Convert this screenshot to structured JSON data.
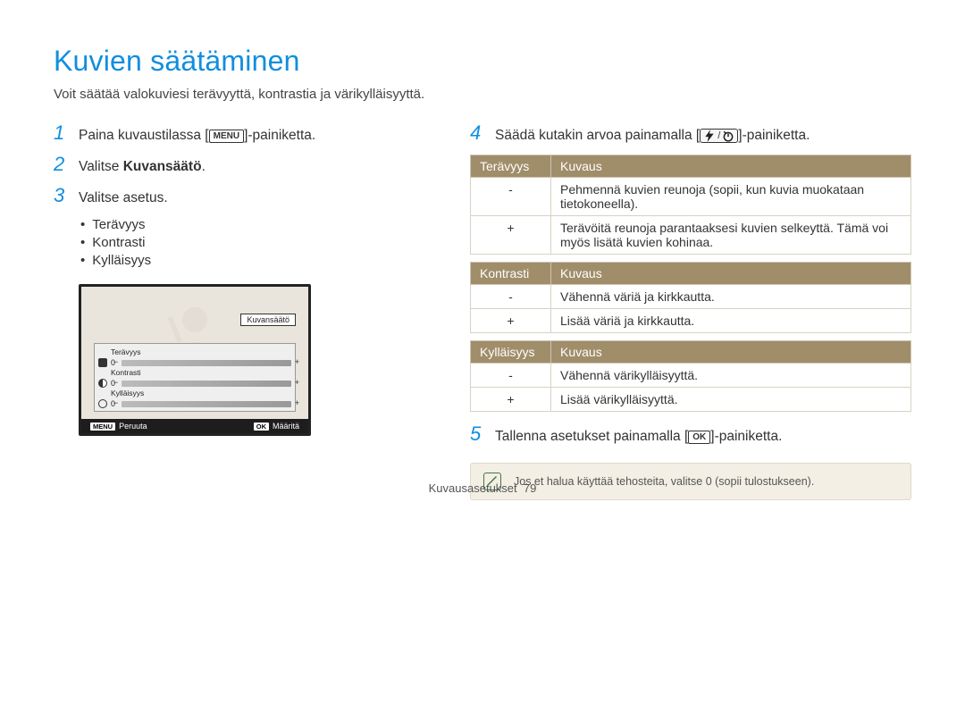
{
  "title": "Kuvien säätäminen",
  "subtitle": "Voit säätää valokuviesi terävyyttä, kontrastia ja värikylläisyyttä.",
  "steps": {
    "s1": {
      "num": "1",
      "pre": "Paina kuvaustilassa [",
      "icon": "MENU",
      "post": "]-painiketta."
    },
    "s2": {
      "num": "2",
      "pre": "Valitse ",
      "bold": "Kuvansäätö",
      "post": "."
    },
    "s3": {
      "num": "3",
      "text": "Valitse asetus."
    },
    "s4": {
      "num": "4",
      "pre": "Säädä kutakin arvoa painamalla [",
      "iconA": "flash-icon",
      "slash": "/",
      "iconB": "timer-icon",
      "post": "]-painiketta."
    },
    "s5": {
      "num": "5",
      "pre": "Tallenna asetukset painamalla [",
      "icon": "OK",
      "post": "]-painiketta."
    }
  },
  "bullets": [
    "Terävyys",
    "Kontrasti",
    "Kylläisyys"
  ],
  "lcd": {
    "title": "Kuvansäätö",
    "rows": [
      {
        "label": "Terävyys",
        "icon": "sq"
      },
      {
        "label": "Kontrasti",
        "icon": "half"
      },
      {
        "label": "Kylläisyys",
        "icon": "circ"
      }
    ],
    "zero": "0",
    "cancel_tag": "MENU",
    "cancel_label": "Peruuta",
    "ok_tag": "OK",
    "ok_label": "Määritä"
  },
  "tables": {
    "t1": {
      "h1": "Terävyys",
      "h2": "Kuvaus",
      "rows": [
        {
          "s": "-",
          "d": "Pehmennä kuvien reunoja (sopii, kun kuvia muokataan tietokoneella)."
        },
        {
          "s": "+",
          "d": "Terävöitä reunoja parantaaksesi kuvien selkeyttä. Tämä voi myös lisätä kuvien kohinaa."
        }
      ]
    },
    "t2": {
      "h1": "Kontrasti",
      "h2": "Kuvaus",
      "rows": [
        {
          "s": "-",
          "d": "Vähennä väriä ja kirkkautta."
        },
        {
          "s": "+",
          "d": "Lisää väriä ja kirkkautta."
        }
      ]
    },
    "t3": {
      "h1": "Kylläisyys",
      "h2": "Kuvaus",
      "rows": [
        {
          "s": "-",
          "d": "Vähennä värikylläisyyttä."
        },
        {
          "s": "+",
          "d": "Lisää värikylläisyyttä."
        }
      ]
    }
  },
  "note": "Jos et halua käyttää tehosteita, valitse 0 (sopii tulostukseen).",
  "footer": {
    "section": "Kuvausasetukset",
    "page": "79"
  }
}
